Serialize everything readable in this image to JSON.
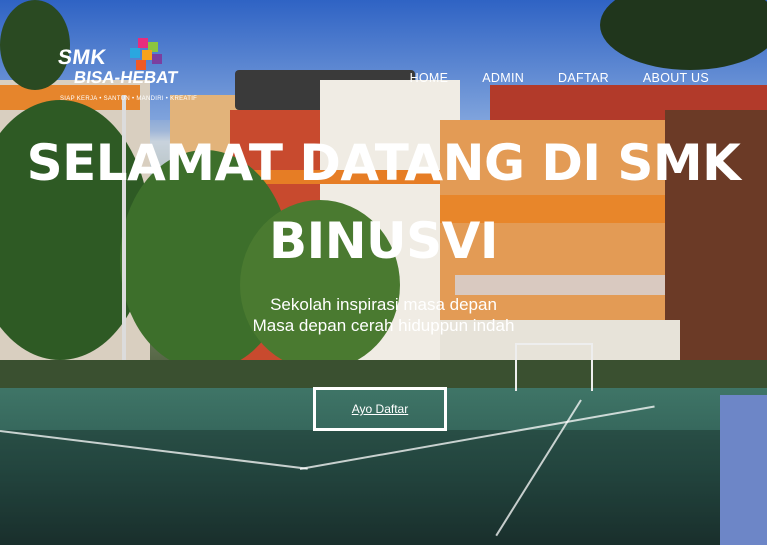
{
  "brand": {
    "line1": "SMK",
    "line2": "BISA-HEBAT",
    "tagline": "SIAP KERJA • SANTUN • MANDIRI • KREATIF"
  },
  "nav": {
    "items": [
      "HOME",
      "ADMIN",
      "DAFTAR",
      "ABOUT US"
    ]
  },
  "hero": {
    "title_line1": "SELAMAT DATANG DI SMK",
    "title_line2": "BINUSVI",
    "subtitle_line1": "Sekolah inspirasi masa depan",
    "subtitle_line2": "Masa depan cerah hiduppun indah",
    "cta_label": "Ayo Daftar"
  },
  "colors": {
    "text": "#ffffff",
    "accent_orange": "#e8862a",
    "sky": "#4a7bd0"
  }
}
